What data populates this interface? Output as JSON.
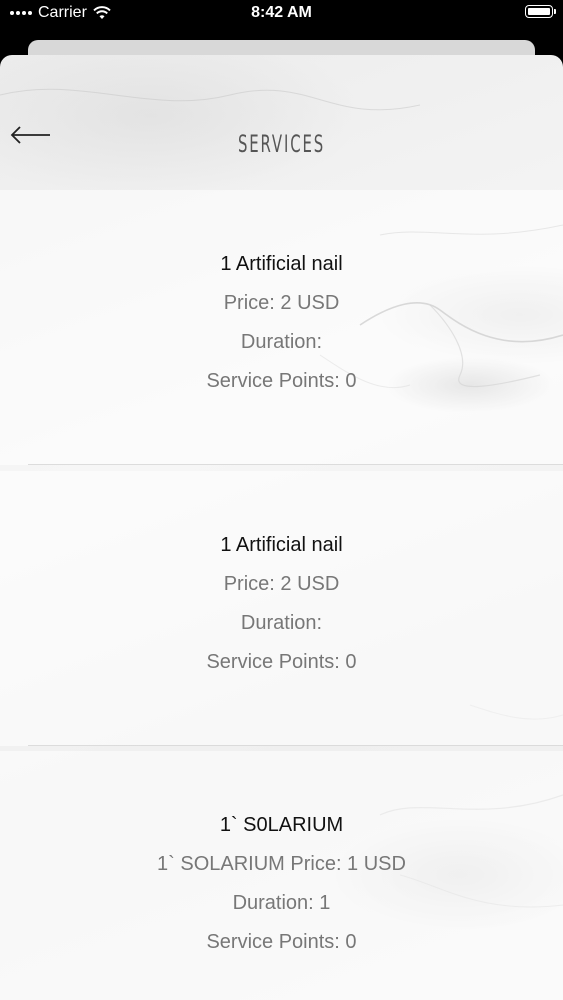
{
  "status_bar": {
    "carrier": "Carrier",
    "time": "8:42 AM"
  },
  "header": {
    "title": "SERVICES"
  },
  "services": [
    {
      "name": "1 Artificial nail",
      "price": "Price: 2 USD",
      "duration": "Duration:",
      "points": "Service Points: 0"
    },
    {
      "name": "1 Artificial nail",
      "price": "Price: 2 USD",
      "duration": "Duration:",
      "points": "Service Points: 0"
    },
    {
      "name": "1` S0LARIUM",
      "price": "1` SOLARIUM Price: 1 USD",
      "duration": "Duration: 1",
      "points": "Service Points: 0"
    }
  ]
}
